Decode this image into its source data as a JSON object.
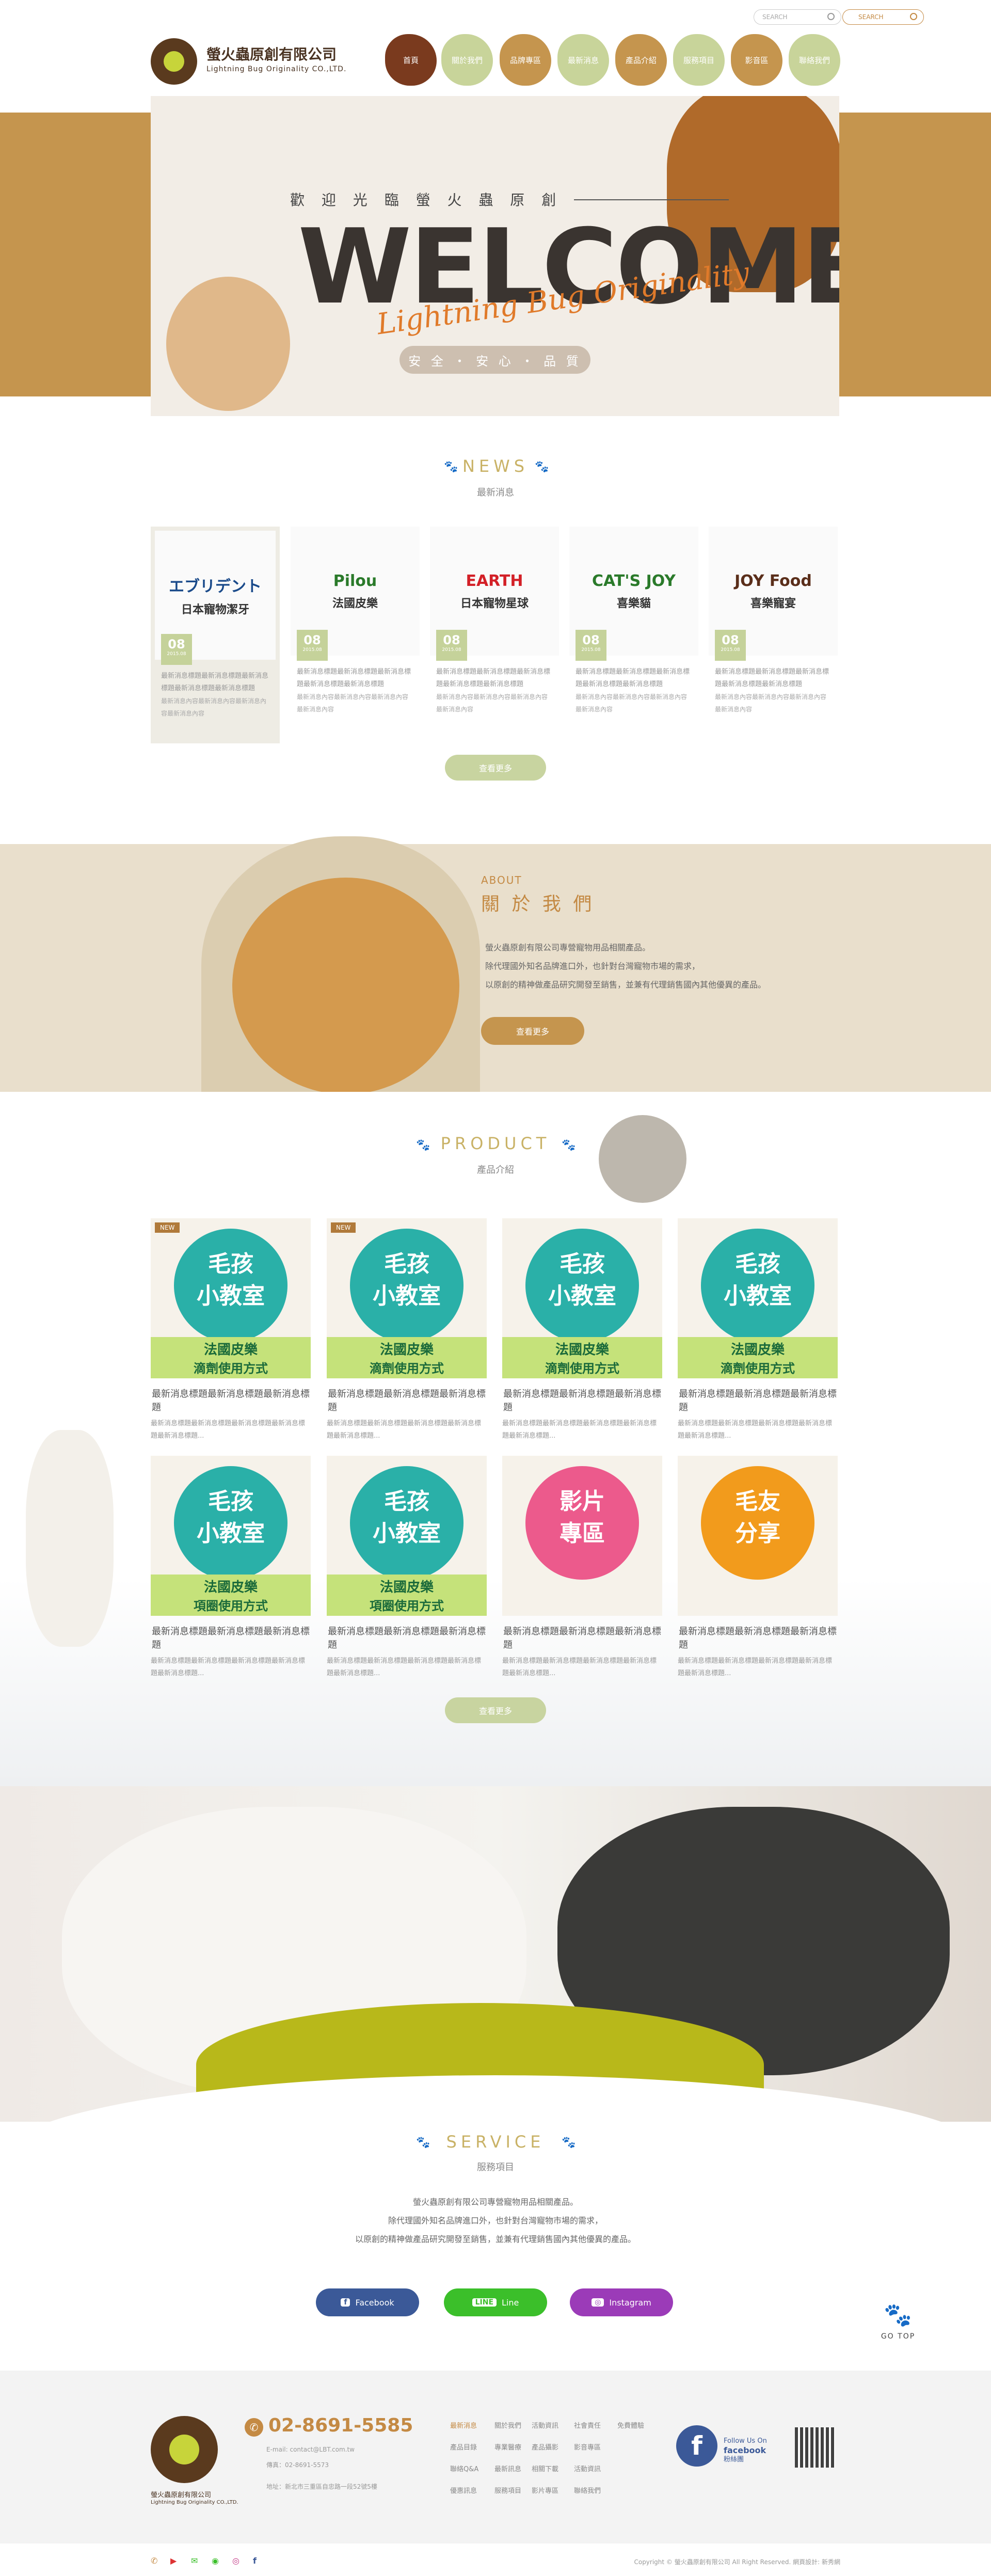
{
  "header": {
    "search_placeholder": "SEARCH",
    "search2_placeholder": "SEARCH",
    "company_name": "螢火蟲原創有限公司",
    "company_en": "Lightning Bug Originality CO.,LTD.",
    "nav": [
      "首頁",
      "關於我們",
      "品牌專區",
      "最新消息",
      "產品介紹",
      "服務項目",
      "影音區",
      "聯絡我們"
    ],
    "nav_colors": [
      "#7a3a1e",
      "#c8d49a",
      "#c5954e",
      "#c8d49a",
      "#c5954e",
      "#c8d49a",
      "#c5954e",
      "#c8d49a"
    ]
  },
  "hero": {
    "subtitle": "歡 迎 光 臨 螢 火 蟲 原 創",
    "welcome": "WELCOME",
    "script": "Lightning Bug Originality",
    "pill": "安 全 ・ 安 心 ・ 品 質"
  },
  "news": {
    "title": "NEWS",
    "subtitle": "最新消息",
    "items": [
      {
        "brand": "エブリデント",
        "brand_sub": "日本寵物潔牙",
        "day": "08",
        "ym": "2015.08",
        "text": "最新消息標題最新消息標題最新消息標題最新消息標題最新消息標題",
        "desc": "最新消息內容最新消息內容最新消息內容最新消息內容"
      },
      {
        "brand": "Pilou",
        "brand_sub": "法國皮樂",
        "day": "08",
        "ym": "2015.08",
        "text": "最新消息標題最新消息標題最新消息標題最新消息標題最新消息標題",
        "desc": "最新消息內容最新消息內容最新消息內容最新消息內容"
      },
      {
        "brand": "EARTH",
        "brand_sub": "日本寵物星球",
        "day": "08",
        "ym": "2015.08",
        "text": "最新消息標題最新消息標題最新消息標題最新消息標題最新消息標題",
        "desc": "最新消息內容最新消息內容最新消息內容最新消息內容"
      },
      {
        "brand": "CAT'S JOY",
        "brand_sub": "喜樂貓",
        "day": "08",
        "ym": "2015.08",
        "text": "最新消息標題最新消息標題最新消息標題最新消息標題最新消息標題",
        "desc": "最新消息內容最新消息內容最新消息內容最新消息內容"
      },
      {
        "brand": "JOY Food",
        "brand_sub": "喜樂寵宴",
        "day": "08",
        "ym": "2015.08",
        "text": "最新消息標題最新消息標題最新消息標題最新消息標題最新消息標題",
        "desc": "最新消息內容最新消息內容最新消息內容最新消息內容"
      }
    ],
    "more": "查看更多"
  },
  "about": {
    "en": "ABOUT",
    "title": "關 於 我 們",
    "lines": [
      "螢火蟲原創有限公司專營寵物用品相關產品。",
      "除代理國外知名品牌進口外，也針對台灣寵物市場的需求，",
      "以原創的精神做產品研究開發至銷售，並兼有代理銷售國內其他優異的產品。"
    ],
    "more": "查看更多"
  },
  "product": {
    "title": "PRODUCT",
    "subtitle": "產品介紹",
    "items": [
      {
        "badge": "NEW",
        "img_t1": "毛孩",
        "img_t2": "小教室",
        "img_t3": "法國皮樂",
        "img_t4": "滴劑使用方式",
        "title": "最新消息標題最新消息標題最新消息標題",
        "desc": "最新消息標題最新消息標題最新消息標題最新消息標題最新消息標題..."
      },
      {
        "badge": "NEW",
        "img_t1": "毛孩",
        "img_t2": "小教室",
        "img_t3": "法國皮樂",
        "img_t4": "滴劑使用方式",
        "title": "最新消息標題最新消息標題最新消息標題",
        "desc": "最新消息標題最新消息標題最新消息標題最新消息標題最新消息標題..."
      },
      {
        "badge": "",
        "img_t1": "毛孩",
        "img_t2": "小教室",
        "img_t3": "法國皮樂",
        "img_t4": "滴劑使用方式",
        "title": "最新消息標題最新消息標題最新消息標題",
        "desc": "最新消息標題最新消息標題最新消息標題最新消息標題最新消息標題..."
      },
      {
        "badge": "",
        "img_t1": "毛孩",
        "img_t2": "小教室",
        "img_t3": "法國皮樂",
        "img_t4": "滴劑使用方式",
        "title": "最新消息標題最新消息標題最新消息標題",
        "desc": "最新消息標題最新消息標題最新消息標題最新消息標題最新消息標題..."
      },
      {
        "badge": "",
        "img_t1": "毛孩",
        "img_t2": "小教室",
        "img_t3": "法國皮樂",
        "img_t4": "項圈使用方式",
        "title": "最新消息標題最新消息標題最新消息標題",
        "desc": "最新消息標題最新消息標題最新消息標題最新消息標題最新消息標題..."
      },
      {
        "badge": "",
        "img_t1": "毛孩",
        "img_t2": "小教室",
        "img_t3": "法國皮樂",
        "img_t4": "項圈使用方式",
        "title": "最新消息標題最新消息標題最新消息標題",
        "desc": "最新消息標題最新消息標題最新消息標題最新消息標題最新消息標題..."
      },
      {
        "badge": "",
        "img_t1": "影片",
        "img_t2": "專區",
        "img_t3": "",
        "img_t4": "",
        "title": "最新消息標題最新消息標題最新消息標題",
        "desc": "最新消息標題最新消息標題最新消息標題最新消息標題最新消息標題..."
      },
      {
        "badge": "",
        "img_t1": "毛友",
        "img_t2": "分享",
        "img_t3": "",
        "img_t4": "",
        "title": "最新消息標題最新消息標題最新消息標題",
        "desc": "最新消息標題最新消息標題最新消息標題最新消息標題最新消息標題..."
      }
    ],
    "more": "查看更多"
  },
  "service": {
    "title": "SERVICE",
    "subtitle": "服務項目",
    "lines": [
      "螢火蟲原創有限公司專營寵物用品相關產品。",
      "除代理國外知名品牌進口外，也針對台灣寵物市場的需求，",
      "以原創的精神做產品研究開發至銷售，並兼有代理銷售國內其他優異的產品。"
    ],
    "social": [
      {
        "label": "Facebook",
        "icon": "f",
        "color": "#3b5998"
      },
      {
        "label": "Line",
        "icon": "LINE",
        "color": "#3bbf2a"
      },
      {
        "label": "Instagram",
        "icon": "◎",
        "color": "#9b3bb8"
      }
    ]
  },
  "gotop": "GO TOP",
  "footer": {
    "company": "螢火蟲原創有限公司",
    "company_en": "Lightning Bug Originality CO.,LTD.",
    "phone": "02-8691-5585",
    "email": "E-mail: contact@LBT.com.tw",
    "fax": "傳真：02-8691-5573",
    "address": "地址：新北市三重區自忠路一段52號5樓",
    "links": [
      [
        "最新消息",
        "關於我們",
        "活動資訊",
        "社會責任",
        "免費體驗"
      ],
      [
        "產品目錄",
        "專業醫療",
        "產品攝影",
        "影音專區",
        ""
      ],
      [
        "聯絡Q&A",
        "最新訊息",
        "相關下載",
        "活動資訊",
        ""
      ],
      [
        "優惠訊息",
        "服務項目",
        "影片專區",
        "聯絡我們",
        ""
      ]
    ],
    "fb_text1": "Follow Us On",
    "fb_text2": "facebook",
    "fb_text3": "粉絲團",
    "copyright": "Copyright © 螢火蟲原創有限公司 All Right Reserved. 網頁設計: 新秀網"
  }
}
